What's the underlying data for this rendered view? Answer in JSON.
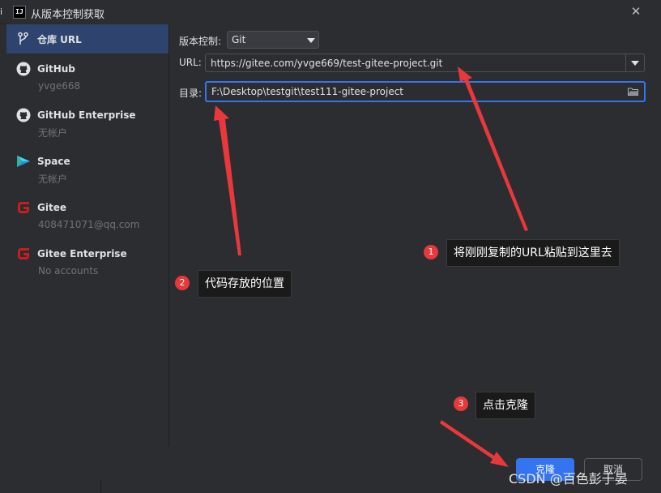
{
  "window": {
    "title": "从版本控制获取",
    "logo_text": "IJ",
    "edge_fragment": "i"
  },
  "sidebar": {
    "items": [
      {
        "label": "仓库 URL",
        "sub": "",
        "icon": "vcs-branch-icon"
      },
      {
        "label": "GitHub",
        "sub": "yvge668",
        "icon": "github-icon"
      },
      {
        "label": "GitHub Enterprise",
        "sub": "无帐户",
        "icon": "github-icon"
      },
      {
        "label": "Space",
        "sub": "无帐户",
        "icon": "space-icon"
      },
      {
        "label": "Gitee",
        "sub": "408471071@qq.com",
        "icon": "gitee-icon"
      },
      {
        "label": "Gitee Enterprise",
        "sub": "No accounts",
        "icon": "gitee-icon"
      }
    ]
  },
  "form": {
    "vcs_label": "版本控制:",
    "vcs_value": "Git",
    "url_label": "URL:",
    "url_value": "https://gitee.com/yvge669/test-gitee-project.git",
    "dir_label": "目录:",
    "dir_value": "F:\\Desktop\\testgit\\test111-gitee-project"
  },
  "footer": {
    "clone_label": "克隆",
    "cancel_label": "取消"
  },
  "annotations": [
    {
      "num": "1",
      "text": "将刚刚复制的URL粘贴到这里去"
    },
    {
      "num": "2",
      "text": "代码存放的位置"
    },
    {
      "num": "3",
      "text": "点击克隆"
    }
  ],
  "watermark": "CSDN @百色彭于晏",
  "colors": {
    "background": "#2b2d30",
    "selected": "#2e436e",
    "accent": "#3574f0",
    "annotation_red": "#e8383b",
    "gitee_red": "#c71d23"
  }
}
